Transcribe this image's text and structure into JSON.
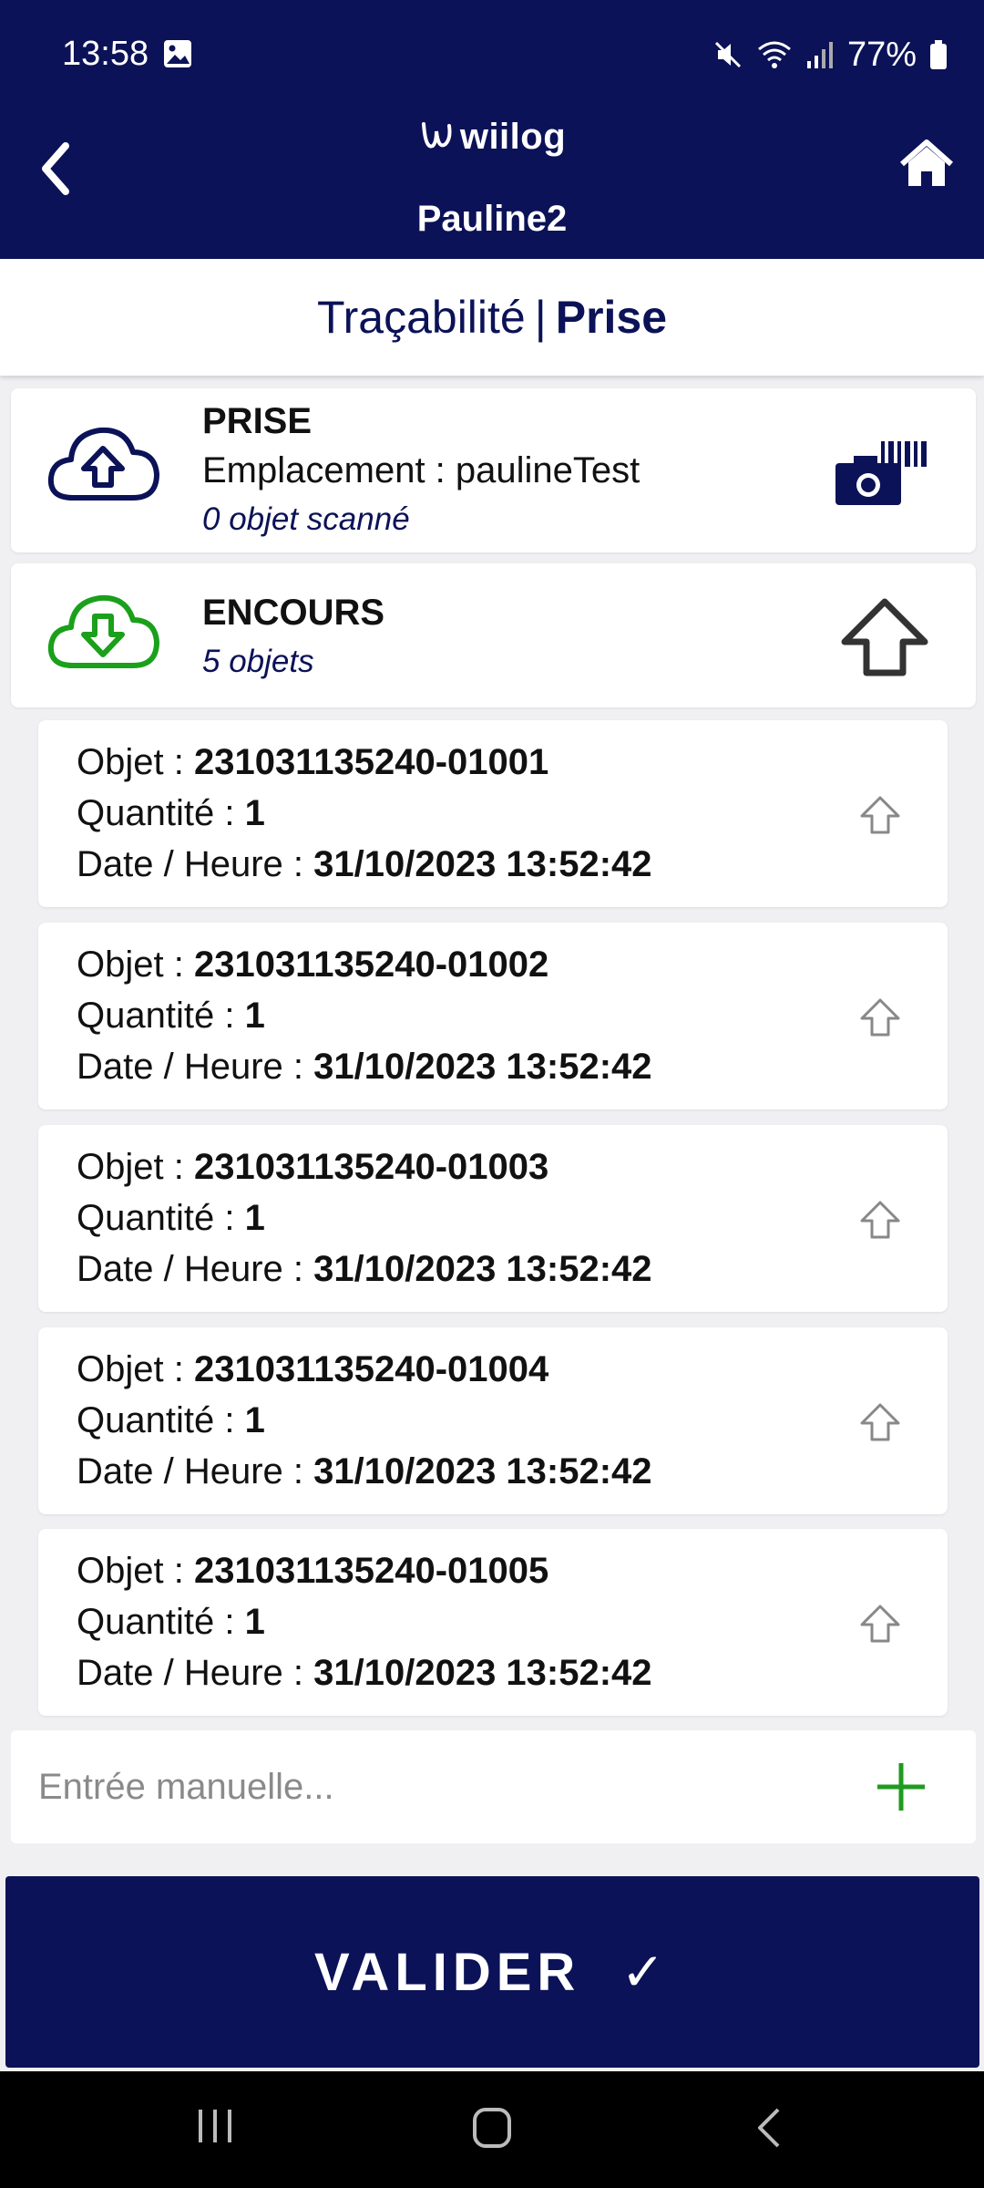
{
  "status_bar": {
    "time": "13:58",
    "battery": "77%"
  },
  "header": {
    "logo_text": "wiilog",
    "user_name": "Pauline2"
  },
  "title": {
    "left": "Traçabilité",
    "separator": "|",
    "right": "Prise"
  },
  "prise_card": {
    "title": "PRISE",
    "location": "Emplacement : paulineTest",
    "scanned": "0 objet scanné"
  },
  "encours_card": {
    "title": "ENCOURS",
    "count": "5 objets"
  },
  "items": [
    {
      "objet_label": "Objet : ",
      "objet": "231031135240-01001",
      "quantite_label": "Quantité : ",
      "quantite": "1",
      "date_label": "Date / Heure : ",
      "date": "31/10/2023 13:52:42"
    },
    {
      "objet_label": "Objet : ",
      "objet": "231031135240-01002",
      "quantite_label": "Quantité : ",
      "quantite": "1",
      "date_label": "Date / Heure : ",
      "date": "31/10/2023 13:52:42"
    },
    {
      "objet_label": "Objet : ",
      "objet": "231031135240-01003",
      "quantite_label": "Quantité : ",
      "quantite": "1",
      "date_label": "Date / Heure : ",
      "date": "31/10/2023 13:52:42"
    },
    {
      "objet_label": "Objet : ",
      "objet": "231031135240-01004",
      "quantite_label": "Quantité : ",
      "quantite": "1",
      "date_label": "Date / Heure : ",
      "date": "31/10/2023 13:52:42"
    },
    {
      "objet_label": "Objet : ",
      "objet": "231031135240-01005",
      "quantite_label": "Quantité : ",
      "quantite": "1",
      "date_label": "Date / Heure : ",
      "date": "31/10/2023 13:52:42"
    }
  ],
  "manual_entry": {
    "placeholder": "Entrée manuelle..."
  },
  "validate": {
    "label": "VALIDER",
    "check": "✓"
  },
  "colors": {
    "primary": "#0b1257",
    "upload_green": "#1aa01a",
    "plus_green": "#1f9b1f",
    "background": "#f0f0f2"
  },
  "icons": {
    "back": "chevron-left-icon",
    "home": "home-icon",
    "upload": "cloud-upload-icon",
    "download": "cloud-download-icon",
    "camera": "camera-barcode-icon",
    "arrow_up": "arrow-up-icon",
    "plus": "plus-icon"
  }
}
